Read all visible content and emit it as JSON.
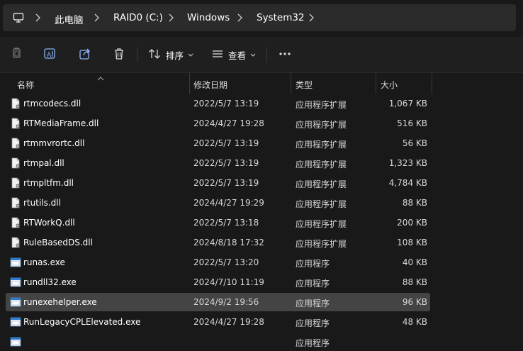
{
  "breadcrumb": {
    "items": [
      "此电脑",
      "RAID0 (C:)",
      "Windows",
      "System32"
    ]
  },
  "toolbar": {
    "sort_label": "排序",
    "view_label": "查看",
    "icons": [
      "copy-icon",
      "rename-icon",
      "share-icon",
      "delete-icon",
      "sort-icon",
      "view-icon",
      "more-icon"
    ]
  },
  "columns": {
    "name": "名称",
    "date": "修改日期",
    "type": "类型",
    "size": "大小"
  },
  "files": [
    {
      "name": "rtmcodecs.dll",
      "date": "2022/5/7 13:19",
      "type": "应用程序扩展",
      "size": "1,067 KB",
      "kind": "dll"
    },
    {
      "name": "RTMediaFrame.dll",
      "date": "2024/4/27 19:28",
      "type": "应用程序扩展",
      "size": "516 KB",
      "kind": "dll"
    },
    {
      "name": "rtmmvrortc.dll",
      "date": "2022/5/7 13:19",
      "type": "应用程序扩展",
      "size": "56 KB",
      "kind": "dll"
    },
    {
      "name": "rtmpal.dll",
      "date": "2022/5/7 13:19",
      "type": "应用程序扩展",
      "size": "1,323 KB",
      "kind": "dll"
    },
    {
      "name": "rtmpltfm.dll",
      "date": "2022/5/7 13:19",
      "type": "应用程序扩展",
      "size": "4,784 KB",
      "kind": "dll"
    },
    {
      "name": "rtutils.dll",
      "date": "2024/4/27 19:29",
      "type": "应用程序扩展",
      "size": "88 KB",
      "kind": "dll"
    },
    {
      "name": "RTWorkQ.dll",
      "date": "2022/5/7 13:18",
      "type": "应用程序扩展",
      "size": "200 KB",
      "kind": "dll"
    },
    {
      "name": "RuleBasedDS.dll",
      "date": "2024/8/18 17:32",
      "type": "应用程序扩展",
      "size": "108 KB",
      "kind": "dll"
    },
    {
      "name": "runas.exe",
      "date": "2022/5/7 13:20",
      "type": "应用程序",
      "size": "40 KB",
      "kind": "exe"
    },
    {
      "name": "rundll32.exe",
      "date": "2024/7/10 11:19",
      "type": "应用程序",
      "size": "88 KB",
      "kind": "exe"
    },
    {
      "name": "runexehelper.exe",
      "date": "2024/9/2 19:56",
      "type": "应用程序",
      "size": "96 KB",
      "kind": "exe",
      "selected": true
    },
    {
      "name": "RunLegacyCPLElevated.exe",
      "date": "2024/4/27 19:28",
      "type": "应用程序",
      "size": "48 KB",
      "kind": "exe"
    },
    {
      "name": "",
      "date": "",
      "type": "应用程序",
      "size": "",
      "kind": "exe"
    }
  ]
}
